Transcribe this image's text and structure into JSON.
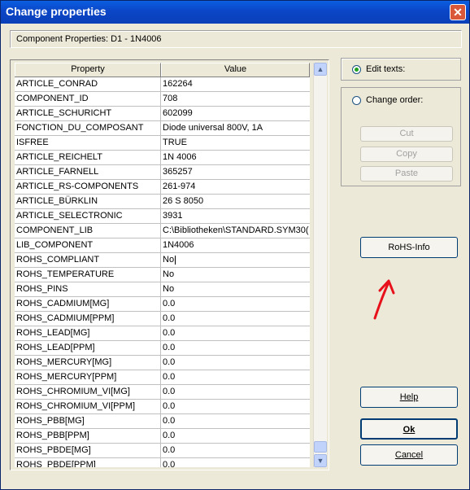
{
  "window": {
    "title": "Change properties",
    "close_symbol": "✕"
  },
  "header": {
    "label": "Component Properties: D1 - 1N4006"
  },
  "grid": {
    "columns": [
      "Property",
      "Value"
    ],
    "rows": [
      [
        "ARTICLE_CONRAD",
        "162264"
      ],
      [
        "COMPONENT_ID",
        "708"
      ],
      [
        "ARTICLE_SCHURICHT",
        "602099"
      ],
      [
        "FONCTION_DU_COMPOSANT",
        "Diode universal 800V, 1A"
      ],
      [
        "ISFREE",
        "TRUE"
      ],
      [
        "ARTICLE_REICHELT",
        "1N 4006"
      ],
      [
        "ARTICLE_FARNELL",
        "365257"
      ],
      [
        "ARTICLE_RS-COMPONENTS",
        "261-974"
      ],
      [
        "ARTICLE_BÜRKLIN",
        "26 S 8050"
      ],
      [
        "ARTICLE_SELECTRONIC",
        "3931"
      ],
      [
        "COMPONENT_LIB",
        "C:\\Bibliotheken\\STANDARD.SYM30("
      ],
      [
        "LIB_COMPONENT",
        "1N4006"
      ],
      [
        "ROHS_COMPLIANT",
        "No"
      ],
      [
        "ROHS_TEMPERATURE",
        "No"
      ],
      [
        "ROHS_PINS",
        "No"
      ],
      [
        "ROHS_CADMIUM[MG]",
        "0.0"
      ],
      [
        "ROHS_CADMIUM[PPM]",
        "0.0"
      ],
      [
        "ROHS_LEAD[MG]",
        "0.0"
      ],
      [
        "ROHS_LEAD[PPM]",
        "0.0"
      ],
      [
        "ROHS_MERCURY[MG]",
        "0.0"
      ],
      [
        "ROHS_MERCURY[PPM]",
        "0.0"
      ],
      [
        "ROHS_CHROMIUM_VI[MG]",
        "0.0"
      ],
      [
        "ROHS_CHROMIUM_VI[PPM]",
        "0.0"
      ],
      [
        "ROHS_PBB[MG]",
        "0.0"
      ],
      [
        "ROHS_PBB[PPM]",
        "0.0"
      ],
      [
        "ROHS_PBDE[MG]",
        "0.0"
      ],
      [
        "ROHS_PBDE[PPM]",
        "0.0"
      ],
      [
        "",
        ""
      ]
    ]
  },
  "options": {
    "edit_texts": "Edit texts:",
    "change_order": "Change order:",
    "cut": "Cut",
    "copy": "Copy",
    "paste": "Paste"
  },
  "buttons": {
    "rohs_info": "RoHS-Info",
    "help": "Help",
    "ok": "Ok",
    "cancel": "Cancel"
  },
  "colors": {
    "annotation_arrow": "#e8101a"
  }
}
